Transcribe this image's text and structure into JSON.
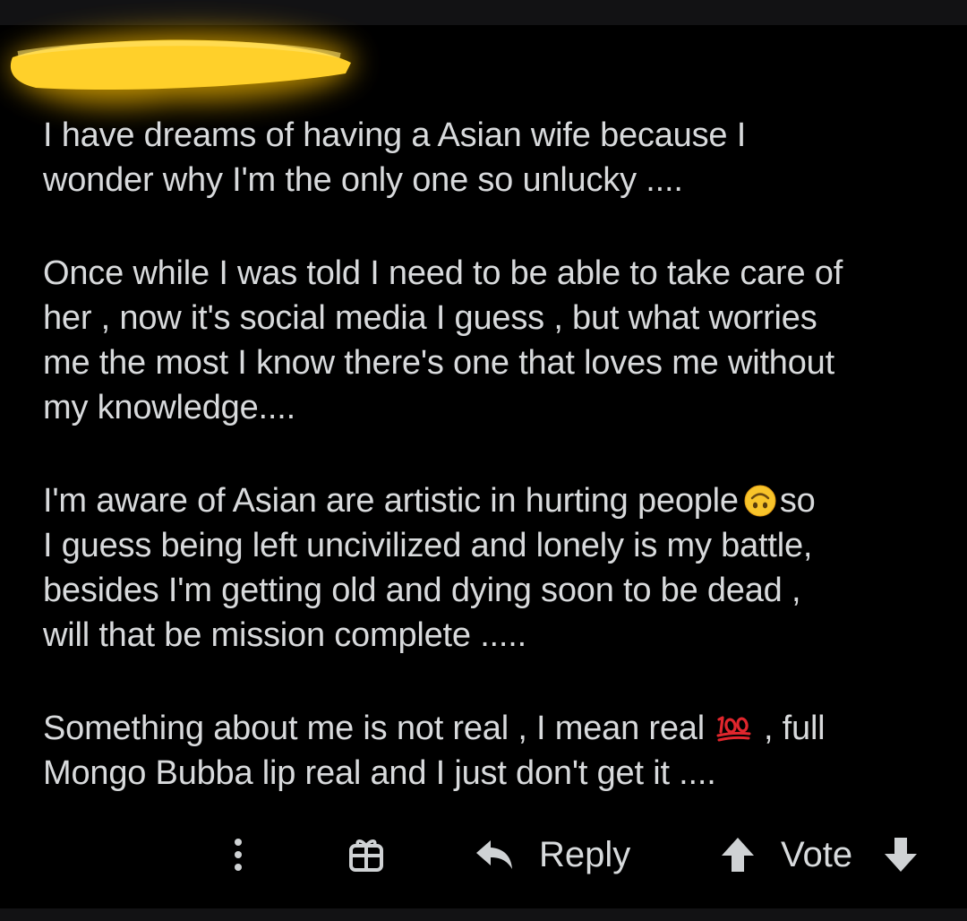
{
  "comment": {
    "paragraphs": [
      "I have dreams of having a Asian wife because I\nwonder why I'm the only one so unlucky ....",
      "Once while I was told I need to be able to take care of\nher , now it's social media I guess , but what worries\nme the most I know there's one that loves me without\nmy knowledge....",
      "I'm aware of Asian are artistic in hurting people",
      "so\nI guess being left uncivilized and lonely is my battle,\nbesides I'm getting old and dying soon to be dead ,\nwill that be mission complete .....",
      "Something about me is not real , I mean real",
      ", full\nMongo Bubba lip real and I just don't get it ...."
    ],
    "emojis": [
      "upside-down-face-emoji",
      "hundred-points-emoji"
    ]
  },
  "actions": {
    "more_icon": "more-vertical-icon",
    "award_icon": "gift-icon",
    "reply_icon": "reply-arrow-icon",
    "reply_label": "Reply",
    "upvote_icon": "arrow-up-icon",
    "vote_label": "Vote",
    "downvote_icon": "arrow-down-icon"
  },
  "colors": {
    "background": "#000000",
    "text": "#d8dadc",
    "redaction_marker": "#ffd02a",
    "emoji_100_red": "#e0262d"
  }
}
